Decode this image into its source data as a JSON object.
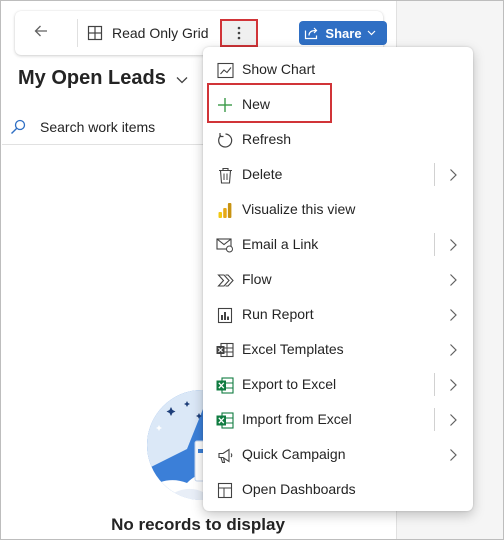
{
  "toolbar": {
    "back_label": "Back",
    "grid_label": "Read Only Grid",
    "more_label": "More commands",
    "share_label": "Share"
  },
  "view": {
    "title": "My Open Leads"
  },
  "search": {
    "placeholder": "Search work items"
  },
  "empty_state": {
    "message": "No records to display"
  },
  "menu": {
    "items": [
      {
        "label": "Show Chart",
        "icon": "chart-icon",
        "submenu": false,
        "split": false
      },
      {
        "label": "New",
        "icon": "plus-icon",
        "submenu": false,
        "split": false
      },
      {
        "label": "Refresh",
        "icon": "refresh-icon",
        "submenu": false,
        "split": false
      },
      {
        "label": "Delete",
        "icon": "trash-icon",
        "submenu": true,
        "split": true
      },
      {
        "label": "Visualize this view",
        "icon": "power-bi-icon",
        "submenu": false,
        "split": false
      },
      {
        "label": "Email a Link",
        "icon": "email-link-icon",
        "submenu": true,
        "split": true
      },
      {
        "label": "Flow",
        "icon": "flow-icon",
        "submenu": true,
        "split": false
      },
      {
        "label": "Run Report",
        "icon": "report-icon",
        "submenu": true,
        "split": false
      },
      {
        "label": "Excel Templates",
        "icon": "excel-templates-icon",
        "submenu": true,
        "split": false
      },
      {
        "label": "Export to Excel",
        "icon": "excel-export-icon",
        "submenu": true,
        "split": true
      },
      {
        "label": "Import from Excel",
        "icon": "excel-import-icon",
        "submenu": true,
        "split": true
      },
      {
        "label": "Quick Campaign",
        "icon": "campaign-icon",
        "submenu": true,
        "split": false
      },
      {
        "label": "Open Dashboards",
        "icon": "dashboard-icon",
        "submenu": false,
        "split": false
      }
    ]
  },
  "colors": {
    "accent": "#2f6fc4",
    "highlight_border": "#d13438",
    "new_icon": "#3a9a48",
    "excel_green": "#107c41",
    "power_bi_yellow": "#f2c811"
  }
}
